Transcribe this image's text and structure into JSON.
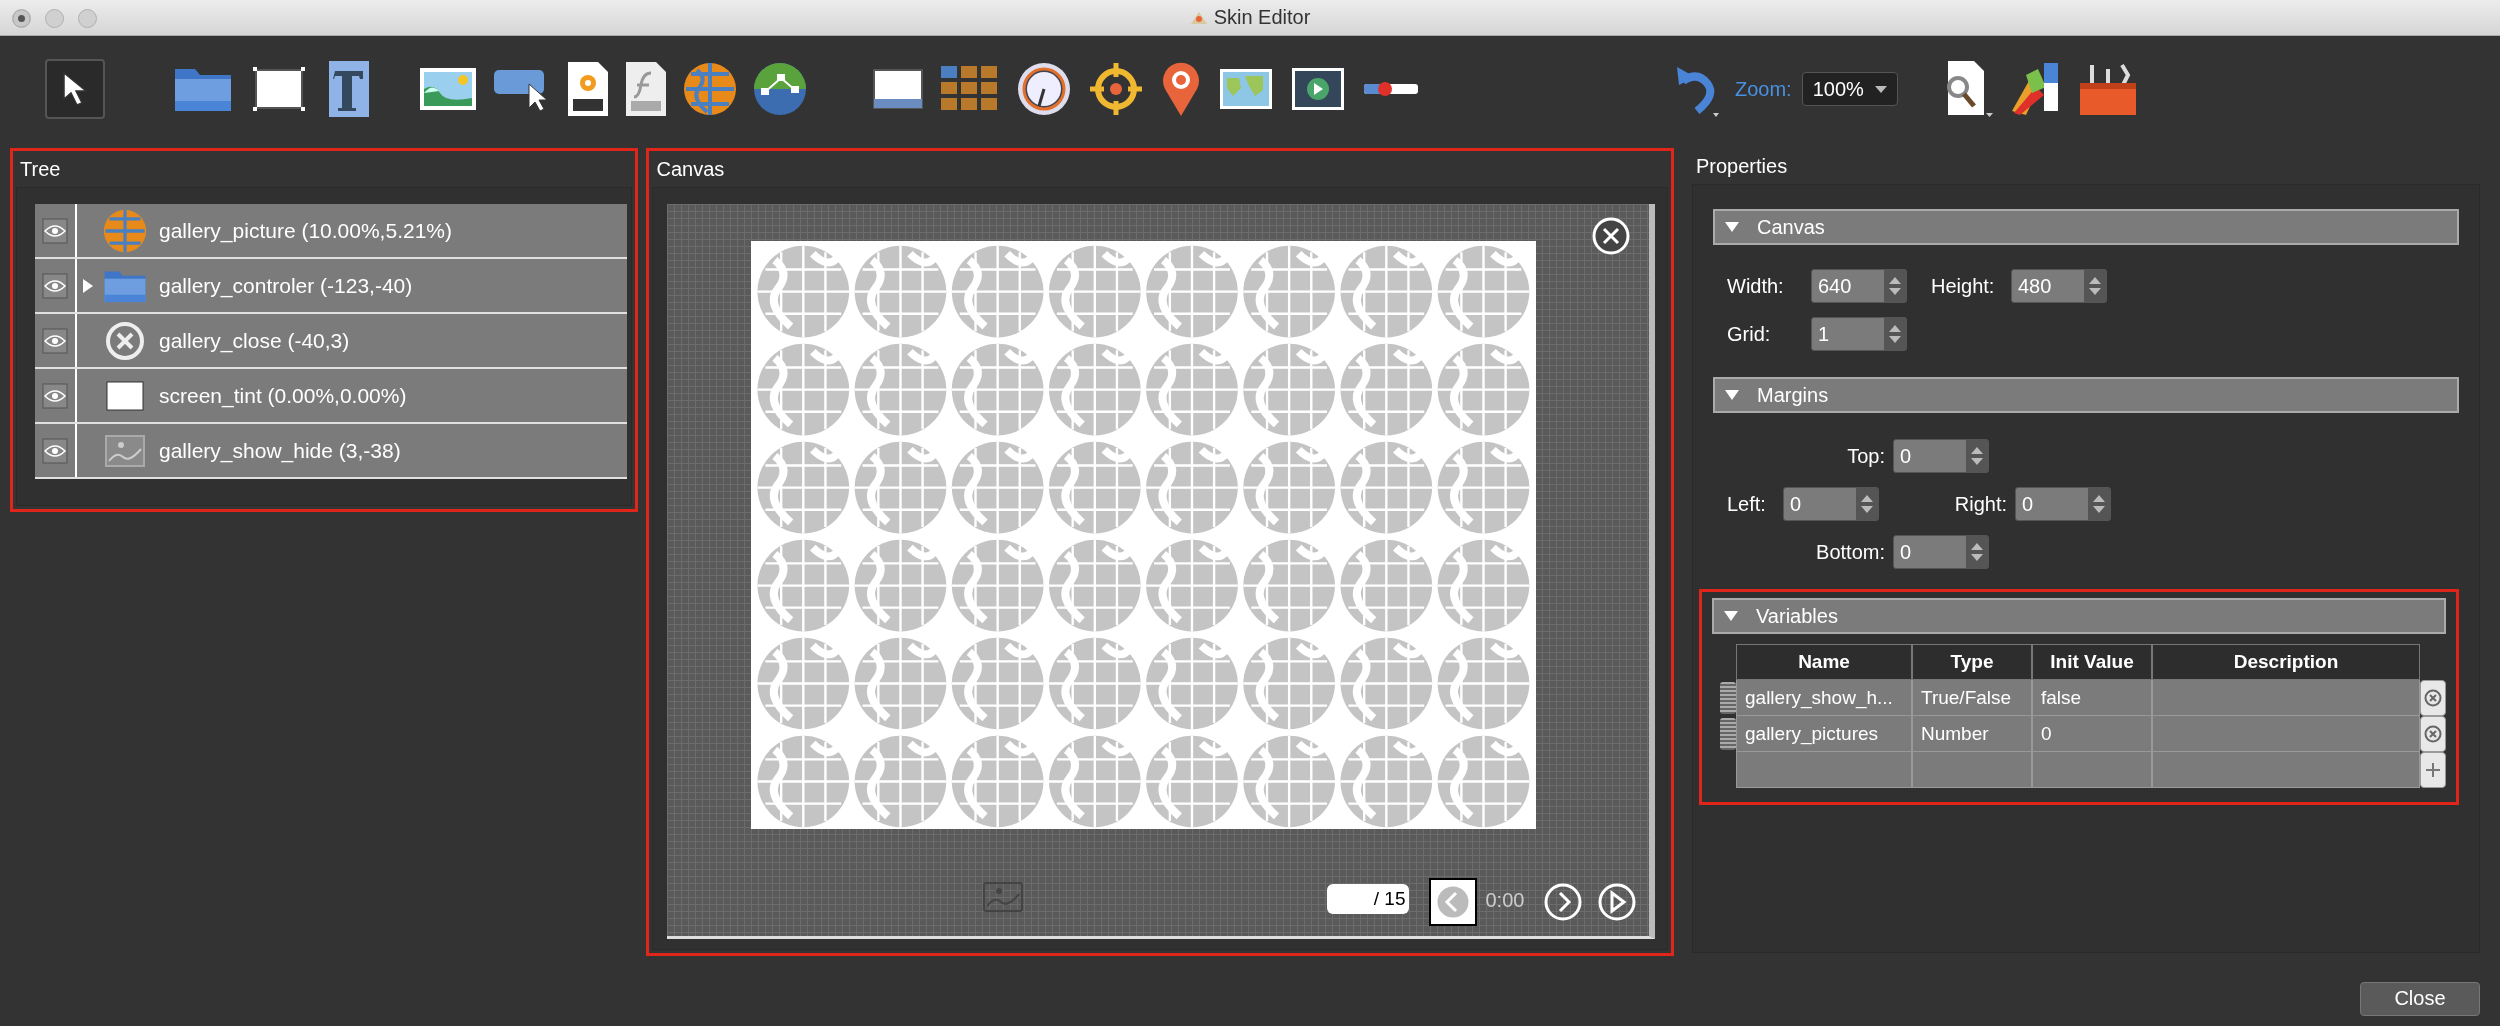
{
  "window": {
    "title": "Skin Editor"
  },
  "toolbar": {
    "zoom_label": "Zoom:",
    "zoom_value": "100%"
  },
  "tree": {
    "title": "Tree",
    "items": [
      {
        "label": "gallery_picture (10.00%,5.21%)",
        "kind": "image",
        "expandable": false
      },
      {
        "label": "gallery_controler (-123,-40)",
        "kind": "folder",
        "expandable": true
      },
      {
        "label": "gallery_close (-40,3)",
        "kind": "close",
        "expandable": false
      },
      {
        "label": "screen_tint (0.00%,0.00%)",
        "kind": "rectangle",
        "expandable": false
      },
      {
        "label": "gallery_show_hide (3,-38)",
        "kind": "picture",
        "expandable": false
      }
    ]
  },
  "canvas": {
    "title": "Canvas",
    "page_field": "/ 15",
    "time": "0:00"
  },
  "properties": {
    "title": "Properties",
    "canvas_section": {
      "title": "Canvas",
      "expanded": true,
      "fields": [
        {
          "label": "Width:",
          "value": "640"
        },
        {
          "label": "Height:",
          "value": "480"
        },
        {
          "label": "Grid:",
          "value": "1"
        }
      ]
    },
    "margins_section": {
      "title": "Margins",
      "expanded": true,
      "fields": [
        {
          "label": "Top:",
          "value": "0"
        },
        {
          "label": "Left:",
          "value": "0"
        },
        {
          "label": "Right:",
          "value": "0"
        },
        {
          "label": "Bottom:",
          "value": "0"
        }
      ]
    },
    "variables_section": {
      "title": "Variables",
      "expanded": true,
      "columns": [
        "Name",
        "Type",
        "Init Value",
        "Description"
      ],
      "rows": [
        {
          "name": "gallery_show_h...",
          "type": "True/False",
          "init_value": "false"
        },
        {
          "name": "gallery_pictures",
          "type": "Number",
          "init_value": "0"
        }
      ]
    }
  },
  "footer": {
    "close_button": "Close"
  }
}
